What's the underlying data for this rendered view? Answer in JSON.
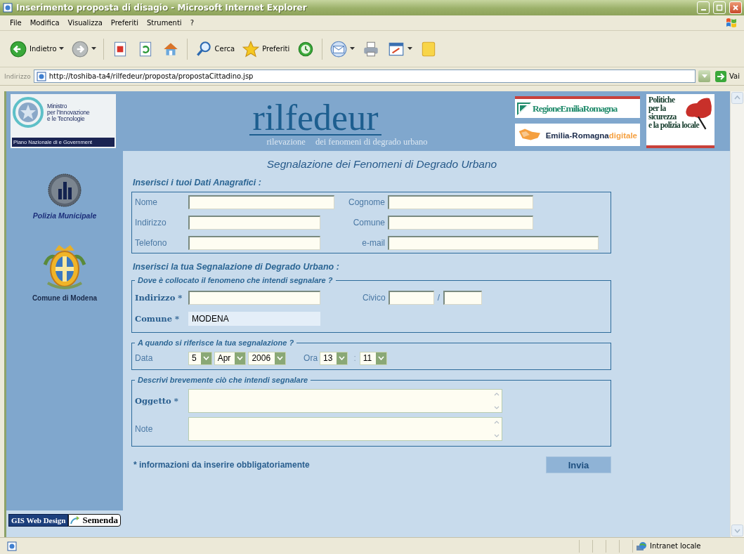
{
  "window": {
    "title": "Inserimento proposta di disagio - Microsoft Internet Explorer"
  },
  "menu": [
    "File",
    "Modifica",
    "Visualizza",
    "Preferiti",
    "Strumenti",
    "?"
  ],
  "toolbar": [
    {
      "kind": "back",
      "label": "Indietro"
    },
    {
      "kind": "forward"
    },
    {
      "kind": "stop"
    },
    {
      "kind": "refresh"
    },
    {
      "kind": "home"
    },
    {
      "kind": "search",
      "label": "Cerca"
    },
    {
      "kind": "favorites",
      "label": "Preferiti"
    },
    {
      "kind": "history"
    },
    {
      "kind": "mail"
    },
    {
      "kind": "print"
    },
    {
      "kind": "edit"
    },
    {
      "kind": "note"
    }
  ],
  "address": {
    "label": "Indirizzo",
    "url": "http://toshiba-ta4/rilfedeur/proposta/propostaCittadino.jsp",
    "go": "Vai"
  },
  "header": {
    "ministry": {
      "lines": [
        "Ministro",
        "per l'Innovazione",
        "e le Tecnologie"
      ],
      "band": "Piano Nazionale di e Government"
    },
    "brand": "rilfedeur",
    "tagline": [
      "rilevazione",
      "dei fenomeni di degrado urbano"
    ],
    "region_logo": "RegioneEmiliaRomagna",
    "digital_logo": {
      "name": "Emilia-Romagna",
      "suffix": "digitale"
    },
    "policy_logo": [
      "Politiche",
      "per la",
      "sicurezza",
      "e la polizia locale"
    ]
  },
  "sidebar": [
    {
      "kind": "police",
      "label": "Polizia Municipale"
    },
    {
      "kind": "crest",
      "label": "Comune di Modena"
    }
  ],
  "form": {
    "title": "Segnalazione dei Fenomeni di Degrado Urbano",
    "personal": {
      "heading": "Inserisci i tuoi Dati Anagrafici :",
      "fields": [
        {
          "label": "Nome"
        },
        {
          "label": "Cognome"
        },
        {
          "label": "Indirizzo"
        },
        {
          "label": "Comune"
        },
        {
          "label": "Telefono"
        },
        {
          "label": "e-mail"
        }
      ]
    },
    "report_heading": "Inserisci la tua Segnalazione di Degrado Urbano :",
    "location": {
      "legend": "Dove è collocato il fenomeno che intendi segnalare ?",
      "address": {
        "label": "Indirizzo *",
        "required": true
      },
      "number": {
        "label": "Civico",
        "required": false,
        "separator": "/"
      },
      "municipality": {
        "label": "Comune *",
        "required": true,
        "value": "MODENA"
      }
    },
    "when": {
      "legend": "A quando si riferisce la tua segnalazione ?",
      "date_label": "Data",
      "date": [
        "5",
        "Apr",
        "2006"
      ],
      "time_label": "Ora",
      "time": [
        "13",
        "11"
      ],
      "time_separator": ":"
    },
    "description": {
      "legend": "Descrivi brevemente ciò che intendi segnalare",
      "fields": [
        {
          "label": "Oggetto *",
          "required": true
        },
        {
          "label": "Note",
          "required": false
        }
      ]
    },
    "footnote": "* informazioni da inserire obbligatoriamente",
    "submit": "Invia"
  },
  "credits": {
    "designer": "GIS Web Design",
    "company": "Semenda"
  },
  "status_bar": {
    "zone": "Intranet locale"
  }
}
